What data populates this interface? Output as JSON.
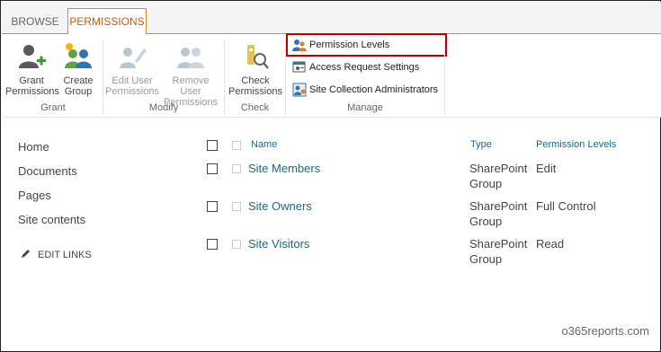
{
  "tabs": [
    {
      "label": "BROWSE"
    },
    {
      "label": "PERMISSIONS"
    }
  ],
  "ribbon": {
    "grant": {
      "label_line1": "Grant",
      "label_line2": "Permissions"
    },
    "create": {
      "label_line1": "Create",
      "label_line2": "Group"
    },
    "edit": {
      "label_line1": "Edit User",
      "label_line2": "Permissions"
    },
    "remove": {
      "label_line1": "Remove User",
      "label_line2": "Permissions"
    },
    "check": {
      "label_line1": "Check",
      "label_line2": "Permissions"
    },
    "manage_items": [
      {
        "label": "Permission Levels",
        "icon": "permission-levels-icon"
      },
      {
        "label": "Access Request Settings",
        "icon": "access-request-icon"
      },
      {
        "label": "Site Collection Administrators",
        "icon": "site-admins-icon"
      }
    ],
    "groups": {
      "grant": "Grant",
      "modify": "Modify",
      "check": "Check",
      "manage": "Manage"
    }
  },
  "nav": {
    "items": [
      {
        "label": "Home"
      },
      {
        "label": "Documents"
      },
      {
        "label": "Pages"
      },
      {
        "label": "Site contents"
      }
    ],
    "edit_links": "EDIT LINKS"
  },
  "table": {
    "headers": {
      "name": "Name",
      "type": "Type",
      "levels": "Permission Levels"
    },
    "rows": [
      {
        "name": "Site Members",
        "type_line1": "SharePoint",
        "type_line2": "Group",
        "level": "Edit"
      },
      {
        "name": "Site Owners",
        "type_line1": "SharePoint",
        "type_line2": "Group",
        "level": "Full Control"
      },
      {
        "name": "Site Visitors",
        "type_line1": "SharePoint",
        "type_line2": "Group",
        "level": "Read"
      }
    ]
  },
  "watermark": "o365reports.com",
  "colors": {
    "accent": "#e08a2c",
    "link": "#0f6b8c",
    "highlight": "#c00000"
  }
}
